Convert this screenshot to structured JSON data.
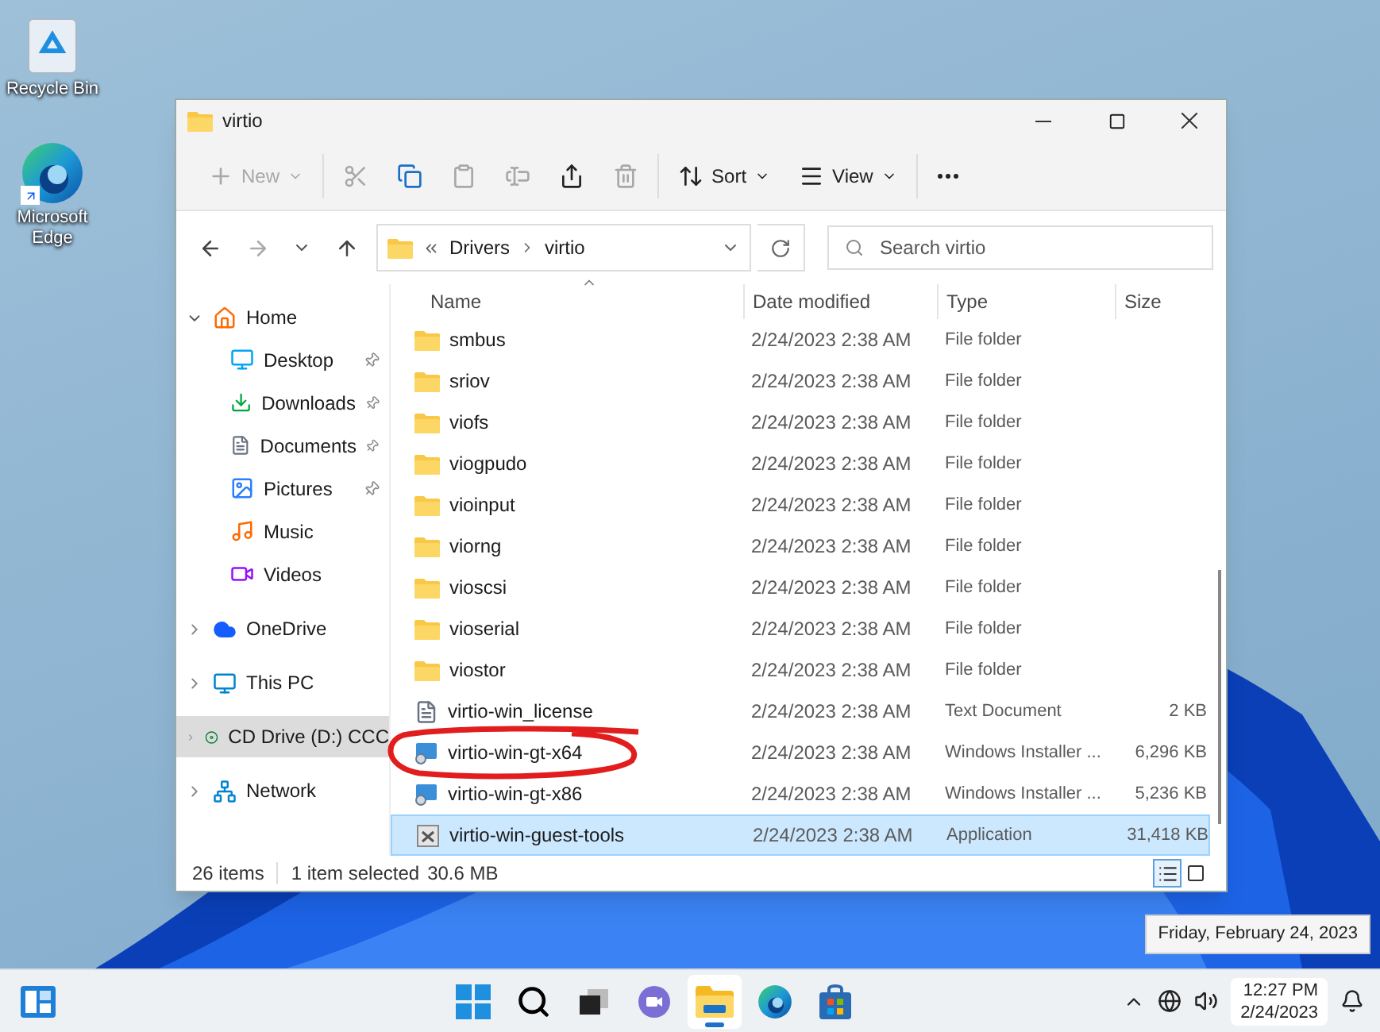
{
  "desktop_icons": [
    {
      "kind": "recycle",
      "label": "Recycle Bin"
    },
    {
      "kind": "edge",
      "label": "Microsoft Edge"
    }
  ],
  "window": {
    "title": "virtio",
    "toolbar": [
      {
        "kind": "new",
        "label": "New",
        "disabled": true
      },
      {
        "kind": "cut",
        "disabled": true
      },
      {
        "kind": "copy",
        "disabled": false
      },
      {
        "kind": "paste",
        "disabled": true
      },
      {
        "kind": "rename",
        "disabled": true
      },
      {
        "kind": "share",
        "disabled": false
      },
      {
        "kind": "delete",
        "disabled": true
      },
      {
        "kind": "sort",
        "label": "Sort",
        "disabled": false
      },
      {
        "kind": "view",
        "label": "View",
        "disabled": false
      },
      {
        "kind": "more",
        "disabled": false
      }
    ],
    "address": {
      "path": [
        "Drivers",
        "virtio"
      ]
    },
    "search": {
      "placeholder": "Search virtio"
    },
    "nav": [
      {
        "kind": "home",
        "label": "Home",
        "expanded": true,
        "selected": false,
        "children": [
          {
            "kind": "desktop",
            "label": "Desktop",
            "pinned": true
          },
          {
            "kind": "downloads",
            "label": "Downloads",
            "pinned": true
          },
          {
            "kind": "documents",
            "label": "Documents",
            "pinned": true
          },
          {
            "kind": "pictures",
            "label": "Pictures",
            "pinned": true
          },
          {
            "kind": "music",
            "label": "Music",
            "pinned": false
          },
          {
            "kind": "videos",
            "label": "Videos",
            "pinned": false
          }
        ]
      },
      {
        "kind": "onedrive",
        "label": "OneDrive",
        "expanded": false,
        "selected": false
      },
      {
        "kind": "pc",
        "label": "This PC",
        "expanded": false,
        "selected": false
      },
      {
        "kind": "cd",
        "label": "CD Drive (D:) CCC",
        "expanded": false,
        "selected": true
      },
      {
        "kind": "network",
        "label": "Network",
        "expanded": false,
        "selected": false
      }
    ],
    "columns": [
      "Name",
      "Date modified",
      "Type",
      "Size"
    ],
    "rows": [
      {
        "kind": "folder",
        "name": "smbus",
        "date": "2/24/2023 2:38 AM",
        "type": "File folder",
        "selected": false
      },
      {
        "kind": "folder",
        "name": "sriov",
        "date": "2/24/2023 2:38 AM",
        "type": "File folder",
        "selected": false
      },
      {
        "kind": "folder",
        "name": "viofs",
        "date": "2/24/2023 2:38 AM",
        "type": "File folder",
        "selected": false
      },
      {
        "kind": "folder",
        "name": "viogpudo",
        "date": "2/24/2023 2:38 AM",
        "type": "File folder",
        "selected": false
      },
      {
        "kind": "folder",
        "name": "vioinput",
        "date": "2/24/2023 2:38 AM",
        "type": "File folder",
        "selected": false
      },
      {
        "kind": "folder",
        "name": "viorng",
        "date": "2/24/2023 2:38 AM",
        "type": "File folder",
        "selected": false
      },
      {
        "kind": "folder",
        "name": "vioscsi",
        "date": "2/24/2023 2:38 AM",
        "type": "File folder",
        "selected": false
      },
      {
        "kind": "folder",
        "name": "vioserial",
        "date": "2/24/2023 2:38 AM",
        "type": "File folder",
        "selected": false
      },
      {
        "kind": "folder",
        "name": "viostor",
        "date": "2/24/2023 2:38 AM",
        "type": "File folder",
        "selected": false
      },
      {
        "kind": "text",
        "name": "virtio-win_license",
        "date": "2/24/2023 2:38 AM",
        "type": "Text Document",
        "size": "2 KB",
        "selected": false
      },
      {
        "kind": "installer",
        "name": "virtio-win-gt-x64",
        "date": "2/24/2023 2:38 AM",
        "type": "Windows Installer ...",
        "size": "6,296 KB",
        "selected": false,
        "circled": true
      },
      {
        "kind": "installer",
        "name": "virtio-win-gt-x86",
        "date": "2/24/2023 2:38 AM",
        "type": "Windows Installer ...",
        "size": "5,236 KB",
        "selected": false,
        "circled": false
      },
      {
        "kind": "app",
        "name": "virtio-win-guest-tools",
        "date": "2/24/2023 2:38 AM",
        "type": "Application",
        "size": "31,418 KB",
        "selected": true
      }
    ],
    "status_bar": {
      "count": "26 items",
      "selection": "1 item selected",
      "size": "30.6 MB",
      "views": [
        {
          "kind": "details",
          "selected": true
        },
        {
          "kind": "tiles",
          "selected": false
        }
      ]
    }
  },
  "taskbar": {
    "apps": [
      {
        "kind": "start"
      },
      {
        "kind": "search"
      },
      {
        "kind": "taskview"
      },
      {
        "kind": "chat"
      },
      {
        "kind": "explorer",
        "active": true
      },
      {
        "kind": "edge",
        "active": false
      },
      {
        "kind": "store",
        "active": false
      }
    ],
    "time": "12:27 PM",
    "date": "2/24/2023",
    "tooltip": "Friday, February 24, 2023"
  }
}
